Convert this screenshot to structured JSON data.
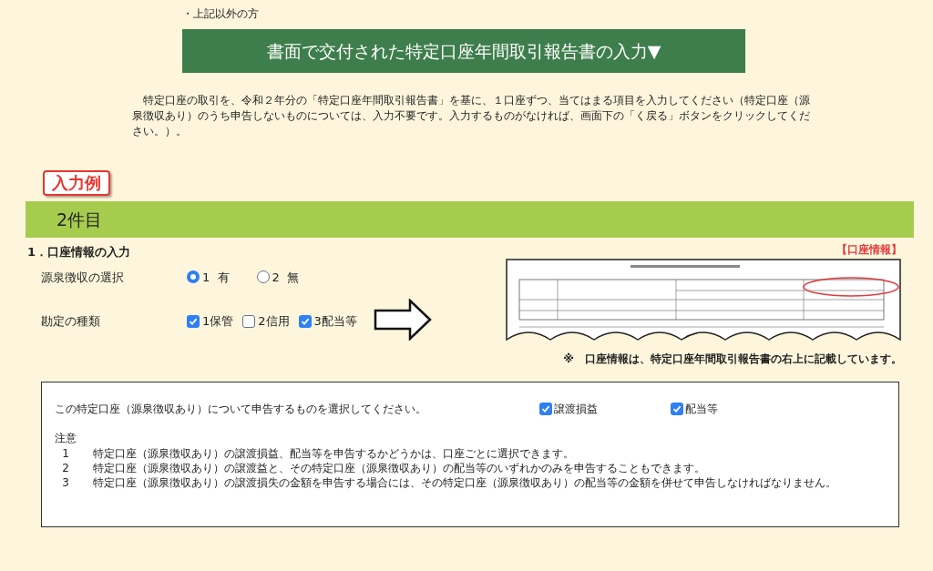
{
  "top_note": "・上記以外の方",
  "banner": "書面で交付された特定口座年間取引報告書の入力▼",
  "intro": "特定口座の取引を、令和２年分の「特定口座年間取引報告書」を基に、１口座ずつ、当てはまる項目を入力してください（特定口座（源泉徴収あり）のうち申告しないものについては、入力不要です。入力するものがなければ、画面下の「く戻る」ボタンをクリックしてください。）。",
  "example_badge": "入力例",
  "section_bar": "2件目",
  "account_info": {
    "heading": "1．口座情報の入力",
    "withholding": {
      "label": "源泉徴収の選択",
      "options": [
        {
          "label": "1  有",
          "selected": true
        },
        {
          "label": "2  無",
          "selected": false
        }
      ]
    },
    "account_type": {
      "label": "勘定の種類",
      "options": [
        {
          "label": "1保管",
          "checked": true
        },
        {
          "label": "2信用",
          "checked": false
        },
        {
          "label": "3配当等",
          "checked": true
        }
      ]
    },
    "image_caption_tag": "【口座情報】",
    "image_note": "※　口座情報は、特定口座年間取引報告書の右上に記載しています。"
  },
  "declare_box": {
    "prompt": "この特定口座（源泉徴収あり）について申告するものを選択してください。",
    "options": [
      {
        "label": "譲渡損益",
        "checked": true
      },
      {
        "label": "配当等",
        "checked": true
      }
    ],
    "notes_title": "注意",
    "notes": [
      {
        "number": "1",
        "text": "特定口座（源泉徴収あり）の譲渡損益、配当等を申告するかどうかは、口座ごとに選択できます。"
      },
      {
        "number": "2",
        "text": "特定口座（源泉徴収あり）の譲渡益と、その特定口座（源泉徴収あり）の配当等のいずれかのみを申告することもできます。"
      },
      {
        "number": "3",
        "text": "特定口座（源泉徴収あり）の譲渡損失の金額を申告する場合には、その特定口座（源泉徴収あり）の配当等の金額を併せて申告しなければなりません。"
      }
    ]
  }
}
